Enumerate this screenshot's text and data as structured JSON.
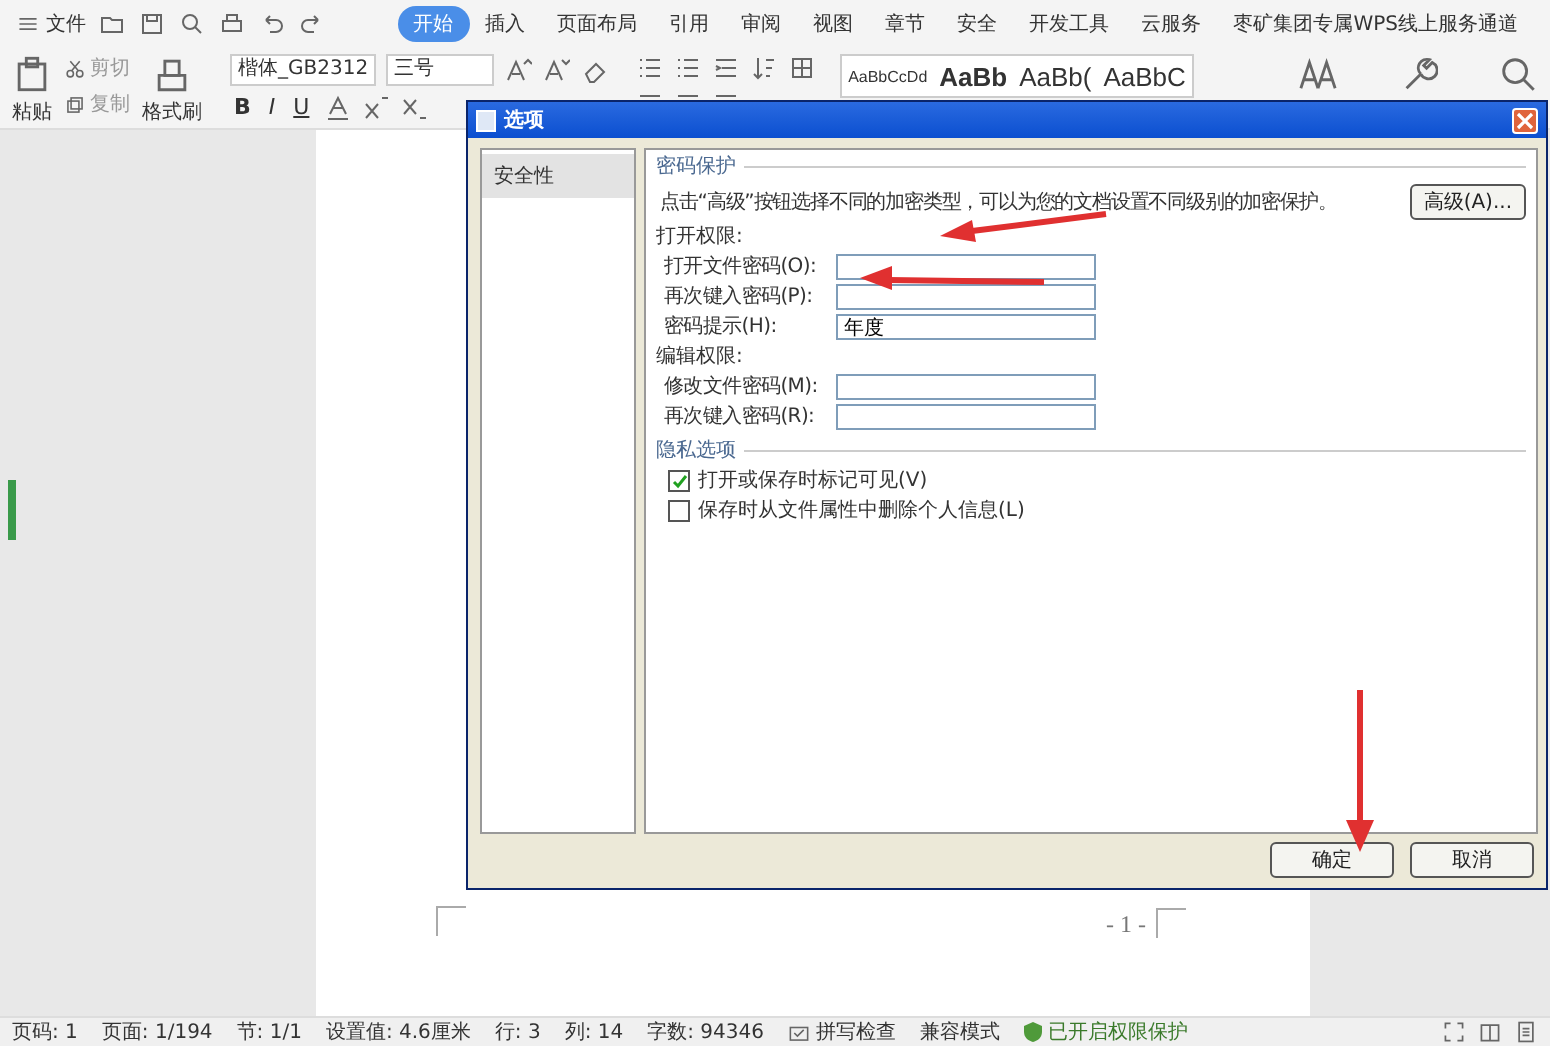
{
  "menu": {
    "file_label": "文件"
  },
  "tabs": [
    {
      "label": "开始",
      "selected": true
    },
    {
      "label": "插入",
      "selected": false
    },
    {
      "label": "页面布局",
      "selected": false
    },
    {
      "label": "引用",
      "selected": false
    },
    {
      "label": "审阅",
      "selected": false
    },
    {
      "label": "视图",
      "selected": false
    },
    {
      "label": "章节",
      "selected": false
    },
    {
      "label": "安全",
      "selected": false
    },
    {
      "label": "开发工具",
      "selected": false
    },
    {
      "label": "云服务",
      "selected": false
    },
    {
      "label": "枣矿集团专属WPS线上服务通道",
      "selected": false
    }
  ],
  "ribbon": {
    "paste_label": "粘贴",
    "cut_label": "剪切",
    "copy_label": "复制",
    "format_painter_label": "格式刷",
    "font": "楷体_GB2312",
    "size": "三号",
    "format_buttons": [
      "B",
      "I",
      "U"
    ],
    "styles": [
      "AaBbCcDd",
      "AaBb",
      "AaBb(",
      "AaBbC"
    ]
  },
  "page": {
    "page_number": "- 1 -"
  },
  "dialog": {
    "title": "选项",
    "nav": [
      {
        "label": "安全性",
        "selected": true
      }
    ],
    "password_group": "密码保护",
    "description": "点击“高级”按钮选择不同的加密类型，可以为您的文档设置不同级别的加密保护。",
    "advanced_button": "高级(A)...",
    "open_section": "打开权限:",
    "open_fields": [
      {
        "label": "打开文件密码(O):"
      },
      {
        "label": "再次键入密码(P):"
      },
      {
        "label": "密码提示(H):",
        "value": "年度"
      }
    ],
    "edit_section": "编辑权限:",
    "edit_fields": [
      {
        "label": "修改文件密码(M):"
      },
      {
        "label": "再次键入密码(R):"
      }
    ],
    "privacy_group": "隐私选项",
    "checkboxes": [
      {
        "label": "打开或保存时标记可见(V)",
        "checked": true
      },
      {
        "label": "保存时从文件属性中删除个人信息(L)",
        "checked": false
      }
    ],
    "buttons": [
      "确定",
      "取消"
    ]
  },
  "status_bar": [
    {
      "kind": "text",
      "text": "页码: 1"
    },
    {
      "kind": "text",
      "text": "页面: 1/194"
    },
    {
      "kind": "text",
      "text": "节: 1/1"
    },
    {
      "kind": "text",
      "text": "设置值: 4.6厘米"
    },
    {
      "kind": "text",
      "text": "行: 3"
    },
    {
      "kind": "text",
      "text": "列: 14"
    },
    {
      "kind": "text",
      "text": "字数: 94346"
    },
    {
      "kind": "spell",
      "text": "拼写检查"
    },
    {
      "kind": "text",
      "text": "兼容模式"
    },
    {
      "kind": "protect",
      "text": "已开启权限保护"
    }
  ]
}
